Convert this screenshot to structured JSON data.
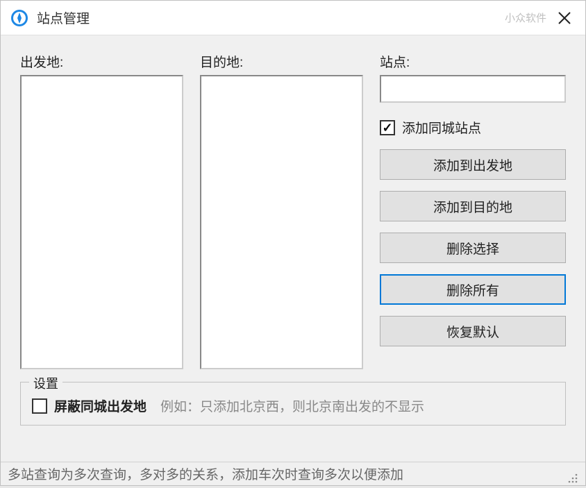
{
  "titlebar": {
    "title": "站点管理",
    "watermark": "小众软件"
  },
  "columns": {
    "departure": {
      "label": "出发地:"
    },
    "destination": {
      "label": "目的地:"
    },
    "station": {
      "label": "站点:",
      "input_value": "",
      "checkbox": {
        "checked": true,
        "label": "添加同城站点"
      },
      "buttons": {
        "add_to_departure": "添加到出发地",
        "add_to_destination": "添加到目的地",
        "delete_selected": "删除选择",
        "delete_all": "删除所有",
        "restore_default": "恢复默认"
      }
    }
  },
  "settings": {
    "legend": "设置",
    "mask_checkbox": {
      "checked": false,
      "label": "屏蔽同城出发地"
    },
    "hint": "例如：只添加北京西，则北京南出发的不显示"
  },
  "statusbar": {
    "text": "多站查询为多次查询，多对多的关系，添加车次时查询多次以便添加"
  }
}
